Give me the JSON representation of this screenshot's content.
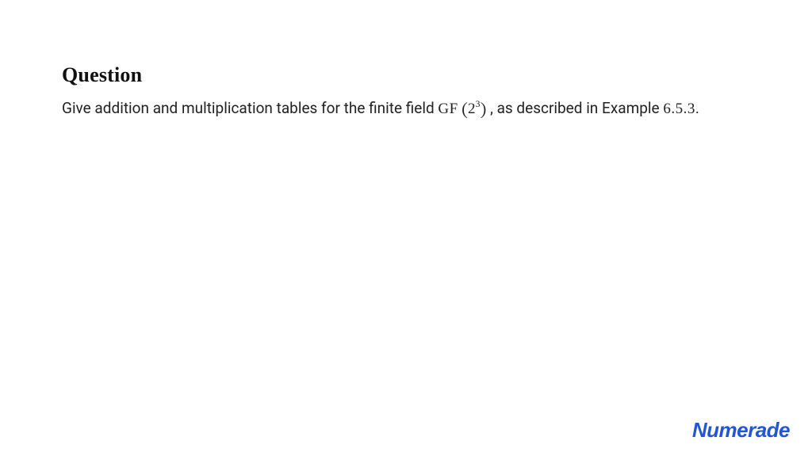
{
  "question": {
    "heading": "Question",
    "text_before_gf": "Give addition and multiplication tables for the finite field ",
    "gf_label": "GF",
    "paren_open": "(",
    "base": "2",
    "exponent": "3",
    "paren_close": ")",
    "comma_space": " , ",
    "text_after": "as described in Example ",
    "example_ref": "6.5.3",
    "period": "."
  },
  "logo": {
    "text": "Numerade"
  }
}
